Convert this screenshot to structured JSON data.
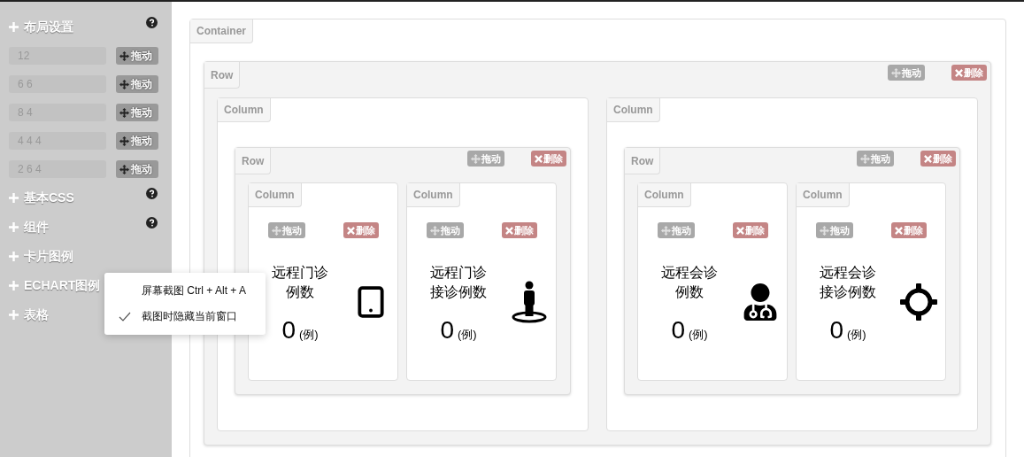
{
  "sidebar": {
    "sections": [
      {
        "title": "布局设置",
        "help": true,
        "items": [
          {
            "value": "12",
            "button": "拖动"
          },
          {
            "value": "6 6",
            "button": "拖动"
          },
          {
            "value": "8 4",
            "button": "拖动"
          },
          {
            "value": "4 4 4",
            "button": "拖动"
          },
          {
            "value": "2 6 4",
            "button": "拖动"
          }
        ]
      },
      {
        "title": "基本CSS",
        "help": true
      },
      {
        "title": "组件",
        "help": true
      },
      {
        "title": "卡片图例",
        "help": false
      },
      {
        "title": "ECHART图例",
        "help": false
      },
      {
        "title": "表格",
        "help": false
      }
    ]
  },
  "container": {
    "label": "Container",
    "row": {
      "label": "Row",
      "drag": "拖动",
      "remove": "删除",
      "columns": [
        {
          "label": "Column",
          "row": {
            "label": "Row",
            "drag": "拖动",
            "remove": "删除",
            "columns": [
              {
                "label": "Column",
                "drag": "拖动",
                "remove": "删除",
                "title": "远程门诊例数",
                "count": "0",
                "unit": "(例)",
                "kind": "tablet"
              },
              {
                "label": "Column",
                "drag": "拖动",
                "remove": "删除",
                "title": "远程门诊接诊例数",
                "count": "0",
                "unit": "(例)",
                "kind": "person"
              }
            ]
          }
        },
        {
          "label": "Column",
          "row": {
            "label": "Row",
            "drag": "拖动",
            "remove": "删除",
            "columns": [
              {
                "label": "Column",
                "drag": "拖动",
                "remove": "删除",
                "title": "远程会诊例数",
                "count": "0",
                "unit": "(例)",
                "kind": "doctor"
              },
              {
                "label": "Column",
                "drag": "拖动",
                "remove": "删除",
                "title": "远程会诊接诊例数",
                "count": "0",
                "unit": "(例)",
                "kind": "crosshair"
              }
            ]
          }
        }
      ]
    }
  },
  "context_menu": {
    "items": [
      {
        "label": "屏幕截图 Ctrl + Alt + A",
        "checked": false
      },
      {
        "label": "截图时隐藏当前窗口",
        "checked": true
      }
    ]
  }
}
